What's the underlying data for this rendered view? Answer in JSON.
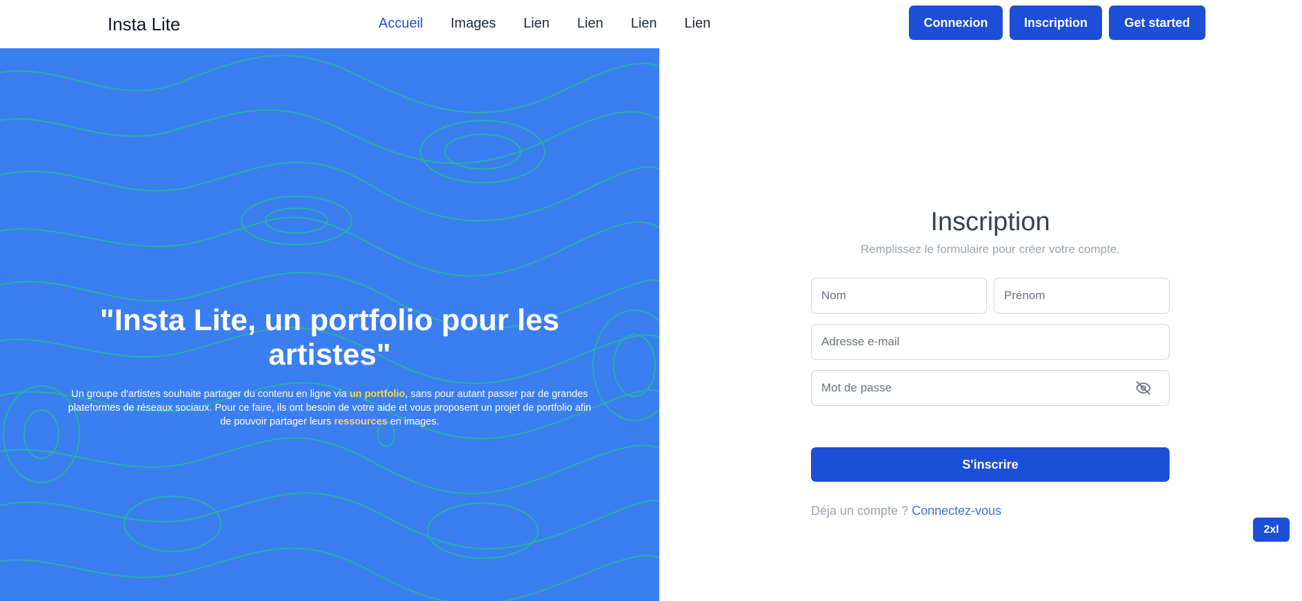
{
  "header": {
    "brand": "Insta Lite",
    "nav": [
      {
        "label": "Accueil",
        "active": true
      },
      {
        "label": "Images",
        "active": false
      },
      {
        "label": "Lien",
        "active": false
      },
      {
        "label": "Lien",
        "active": false
      },
      {
        "label": "Lien",
        "active": false
      },
      {
        "label": "Lien",
        "active": false
      }
    ],
    "buttons": {
      "login": "Connexion",
      "signup": "Inscription",
      "started": "Get started"
    }
  },
  "hero": {
    "title": "\"Insta Lite, un portfolio pour les artistes\"",
    "desc_1": "Un groupe d'artistes souhaite partager du contenu en ligne via ",
    "desc_hl1": "un portfolio",
    "desc_2": ", sans pour autant passer par de grandes plateformes de réseaux sociaux. Pour ce faire, ils ont besoin de votre aide et vous proposent un projet de portfolio afin de pouvoir partager leurs ",
    "desc_hl2": "ressources",
    "desc_3": " en images.",
    "bg_color": "#3b7ef0",
    "line_color": "#22c08a",
    "highlight_color": "#fcd34d"
  },
  "form": {
    "title": "Inscription",
    "subtitle": "Remplissez le formulaire pour créer votre compte.",
    "nom_placeholder": "Nom",
    "prenom_placeholder": "Prénom",
    "email_placeholder": "Adresse e-mail",
    "password_placeholder": "Mot de passe",
    "password_icon": "eye-off-icon",
    "submit": "S'inscrire",
    "login_prompt": "Déja un compte ? ",
    "login_link": "Connectez-vous"
  },
  "badge": "2xl",
  "colors": {
    "primary": "#1d4ed8",
    "muted_text": "#9ca3af"
  }
}
